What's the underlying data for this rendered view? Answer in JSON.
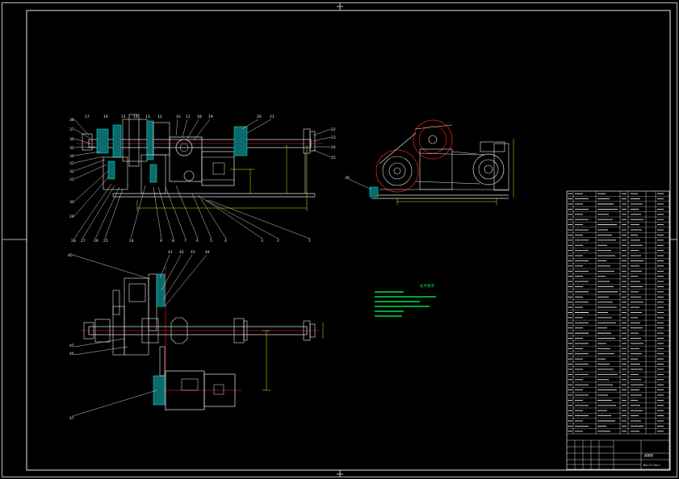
{
  "drawing": {
    "colors": {
      "background": "#000000",
      "outline": "#e8e8e8",
      "centerline": "#ff2020",
      "dimension": "#e6e600",
      "notes": "#00e040",
      "hatch": "#00d8d8"
    },
    "technical_requirements_title": "技术要求",
    "title_block": {
      "drawing_title": "装配图",
      "drawing_number": "BG-07-00-0"
    }
  }
}
